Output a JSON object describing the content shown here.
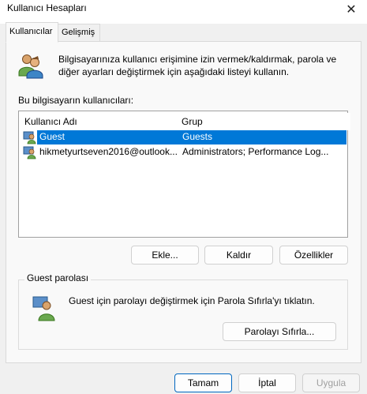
{
  "window": {
    "title": "Kullanıcı Hesapları",
    "close_glyph": "✕"
  },
  "tabs": [
    {
      "label": "Kullanıcılar",
      "active": true
    },
    {
      "label": "Gelişmiş",
      "active": false
    }
  ],
  "intro": {
    "icon": "users-icon",
    "line1": "Bilgisayarınıza kullanıcı erişimine izin vermek/kaldırmak, parola ve",
    "line2": "diğer ayarları değiştirmek için aşağıdaki listeyi kullanın."
  },
  "users_label": "Bu bilgisayarın kullanıcıları:",
  "table": {
    "columns": [
      "Kullanıcı Adı",
      "Grup"
    ],
    "rows": [
      {
        "name": "Guest",
        "group": "Guests",
        "selected": true,
        "icon": "user-icon"
      },
      {
        "name": "hikmetyurtseven2016@outlook...",
        "group": "Administrators; Performance Log...",
        "selected": false,
        "icon": "user-icon"
      }
    ]
  },
  "buttons": {
    "add": "Ekle...",
    "remove": "Kaldır",
    "properties": "Özellikler"
  },
  "password_group": {
    "title": "Guest parolası",
    "icon": "user-key-icon",
    "text": "Guest için parolayı değiştirmek için Parola Sıfırla'yı tıklatın.",
    "reset_button": "Parolayı Sıfırla..."
  },
  "footer": {
    "ok": "Tamam",
    "cancel": "İptal",
    "apply": "Uygula"
  },
  "colors": {
    "selection": "#0078d7",
    "accent_border": "#0067c0"
  }
}
